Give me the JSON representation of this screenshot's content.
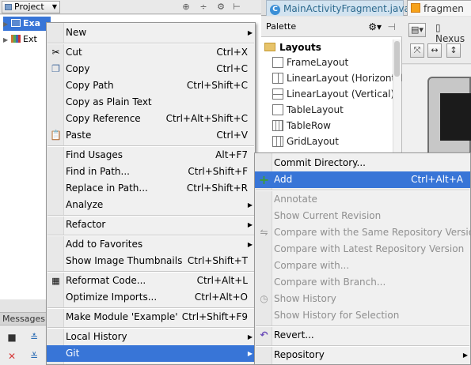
{
  "project_panel": {
    "title": "Project",
    "tree": [
      {
        "label": "Exa"
      },
      {
        "label": "Ext"
      }
    ]
  },
  "messages_panel": {
    "title": "Messages:"
  },
  "editor": {
    "tabs": [
      {
        "label": "MainActivityFragment.java"
      },
      {
        "label": "fragmen"
      }
    ]
  },
  "palette": {
    "title": "Palette",
    "category": "Layouts",
    "items": [
      {
        "label": "FrameLayout"
      },
      {
        "label": "LinearLayout (Horizontal)"
      },
      {
        "label": "LinearLayout (Vertical)"
      },
      {
        "label": "TableLayout"
      },
      {
        "label": "TableRow"
      },
      {
        "label": "GridLayout"
      }
    ]
  },
  "design_toolbar": {
    "device": "Nexus"
  },
  "context_menu": {
    "items": [
      {
        "label": "New",
        "shortcut": "",
        "submenu": true
      },
      {
        "label": "Cut",
        "shortcut": "Ctrl+X",
        "icon": "scissors-icon"
      },
      {
        "label": "Copy",
        "shortcut": "Ctrl+C",
        "icon": "copy-icon"
      },
      {
        "label": "Copy Path",
        "shortcut": "Ctrl+Shift+C"
      },
      {
        "label": "Copy as Plain Text",
        "shortcut": ""
      },
      {
        "label": "Copy Reference",
        "shortcut": "Ctrl+Alt+Shift+C"
      },
      {
        "label": "Paste",
        "shortcut": "Ctrl+V",
        "icon": "paste-icon"
      },
      {
        "label": "Find Usages",
        "shortcut": "Alt+F7"
      },
      {
        "label": "Find in Path...",
        "shortcut": "Ctrl+Shift+F"
      },
      {
        "label": "Replace in Path...",
        "shortcut": "Ctrl+Shift+R"
      },
      {
        "label": "Analyze",
        "shortcut": "",
        "submenu": true
      },
      {
        "label": "Refactor",
        "shortcut": "",
        "submenu": true
      },
      {
        "label": "Add to Favorites",
        "shortcut": "",
        "submenu": true
      },
      {
        "label": "Show Image Thumbnails",
        "shortcut": "Ctrl+Shift+T"
      },
      {
        "label": "Reformat Code...",
        "shortcut": "Ctrl+Alt+L",
        "icon": "reformat-icon"
      },
      {
        "label": "Optimize Imports...",
        "shortcut": "Ctrl+Alt+O"
      },
      {
        "label": "Make Module 'Example'",
        "shortcut": "Ctrl+Shift+F9"
      },
      {
        "label": "Local History",
        "shortcut": "",
        "submenu": true
      },
      {
        "label": "Git",
        "shortcut": "",
        "submenu": true
      }
    ]
  },
  "git_menu": {
    "items": [
      {
        "label": "Commit Directory...",
        "shortcut": ""
      },
      {
        "label": "Add",
        "shortcut": "Ctrl+Alt+A",
        "icon": "plus-icon"
      },
      {
        "label": "Annotate",
        "shortcut": ""
      },
      {
        "label": "Show Current Revision",
        "shortcut": ""
      },
      {
        "label": "Compare with the Same Repository Version",
        "shortcut": "",
        "icon": "compare-icon"
      },
      {
        "label": "Compare with Latest Repository Version",
        "shortcut": ""
      },
      {
        "label": "Compare with...",
        "shortcut": ""
      },
      {
        "label": "Compare with Branch...",
        "shortcut": ""
      },
      {
        "label": "Show History",
        "shortcut": "",
        "icon": "history-icon"
      },
      {
        "label": "Show History for Selection",
        "shortcut": ""
      },
      {
        "label": "Revert...",
        "shortcut": "",
        "icon": "revert-icon"
      },
      {
        "label": "Repository",
        "shortcut": "",
        "submenu": true
      }
    ]
  },
  "colors": {
    "selection": "#3875d7",
    "menu_bg": "#f0f0f0",
    "add_icon": "#3c9a3c",
    "revert_icon": "#6a4bb8"
  }
}
